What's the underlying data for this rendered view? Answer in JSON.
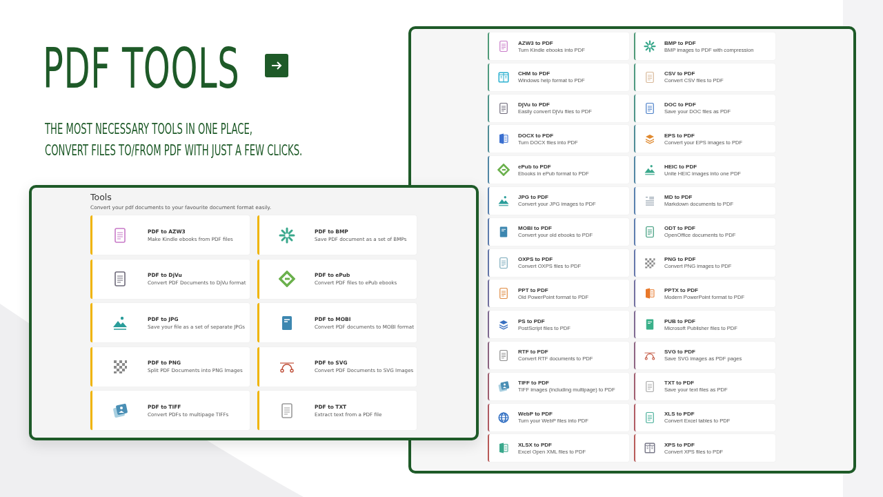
{
  "hero": {
    "title": "PDF TOOLS",
    "subtitle_lines": [
      "THE MOST NECESSARY TOOLS IN ONE PLACE,",
      "CONVERT FILES TO/FROM PDF WITH JUST A FEW CLICKS."
    ]
  },
  "tools_panel": {
    "heading": "Tools",
    "description": "Convert your pdf documents to your favourite document format easily.",
    "cards": [
      {
        "title": "PDF to AZW3",
        "text": "Make Kindle ebooks from PDF files",
        "color": "#f0b400"
      },
      {
        "title": "PDF to BMP",
        "text": "Save PDF document as a set of BMPs",
        "color": "#f0b400"
      },
      {
        "title": "PDF to DjVu",
        "text": "Convert PDF Documents to DjVu format",
        "color": "#f0b400"
      },
      {
        "title": "PDF to ePub",
        "text": "Convert PDF files to ePub ebooks",
        "color": "#f0b400"
      },
      {
        "title": "PDF to JPG",
        "text": "Save your file as a set of separate JPGs",
        "color": "#f0b400"
      },
      {
        "title": "PDF to MOBI",
        "text": "Convert PDF documents to MOBI format",
        "color": "#f0b400"
      },
      {
        "title": "PDF to PNG",
        "text": "Split PDF Documents into PNG Images",
        "color": "#f0b400"
      },
      {
        "title": "PDF to SVG",
        "text": "Convert PDF Documents to SVG Images",
        "color": "#f0b400"
      },
      {
        "title": "PDF to TIFF",
        "text": "Convert PDFs to multipage TIFFs",
        "color": "#f0b400"
      },
      {
        "title": "PDF to TXT",
        "text": "Extract text from a PDF file",
        "color": "#f0b400"
      }
    ]
  },
  "to_pdf_panel": {
    "cards": [
      {
        "title": "AZW3 to PDF",
        "text": "Turn Kindle ebooks into PDF",
        "color": "#4f9a78"
      },
      {
        "title": "BMP to PDF",
        "text": "BMP images to PDF with compression",
        "color": "#4f9a78"
      },
      {
        "title": "CHM to PDF",
        "text": "Windows help format to PDF",
        "color": "#4f9a80"
      },
      {
        "title": "CSV to PDF",
        "text": "Convert CSV files to PDF",
        "color": "#4f9a80"
      },
      {
        "title": "DjVu to PDF",
        "text": "Easily convert DjVu files to PDF",
        "color": "#4e9488"
      },
      {
        "title": "DOC to PDF",
        "text": "Save your DOC files as PDF",
        "color": "#4e9488"
      },
      {
        "title": "DOCX to PDF",
        "text": "Turn DOCX files into PDF",
        "color": "#4f8c96"
      },
      {
        "title": "EPS to PDF",
        "text": "Convert your EPS images to PDF",
        "color": "#4f8c96"
      },
      {
        "title": "ePub to PDF",
        "text": "Ebooks in ePub format to PDF",
        "color": "#5186a4"
      },
      {
        "title": "HEIC to PDF",
        "text": "Unite HEIC images into one PDF",
        "color": "#5186a4"
      },
      {
        "title": "JPG to PDF",
        "text": "Convert your JPG images to PDF",
        "color": "#5880ae"
      },
      {
        "title": "MD to PDF",
        "text": "Markdown documents to PDF",
        "color": "#5880ae"
      },
      {
        "title": "MOBI to PDF",
        "text": "Convert your old ebooks to PDF",
        "color": "#5d7cae"
      },
      {
        "title": "ODT to PDF",
        "text": "OpenOffice documents to PDF",
        "color": "#5d7cae"
      },
      {
        "title": "OXPS to PDF",
        "text": "Convert OXPS files to PDF",
        "color": "#6476aa"
      },
      {
        "title": "PNG to PDF",
        "text": "Convert PNG images to PDF",
        "color": "#6476aa"
      },
      {
        "title": "PPT to PDF",
        "text": "Old PowerPoint format to PDF",
        "color": "#7270a0"
      },
      {
        "title": "PPTX to PDF",
        "text": "Modern PowerPoint format to PDF",
        "color": "#7270a0"
      },
      {
        "title": "PS to PDF",
        "text": "PostScript files to PDF",
        "color": "#7f6a92"
      },
      {
        "title": "PUB to PDF",
        "text": "Microsoft Publisher files to PDF",
        "color": "#7f6a92"
      },
      {
        "title": "RTF to PDF",
        "text": "Convert RTF documents to PDF",
        "color": "#8d6482"
      },
      {
        "title": "SVG to PDF",
        "text": "Save SVG images as PDF pages",
        "color": "#8d6482"
      },
      {
        "title": "TIFF to PDF",
        "text": "TIFF images (including multipage) to PDF",
        "color": "#a05e70"
      },
      {
        "title": "TXT to PDF",
        "text": "Save your text files as PDF",
        "color": "#a05e70"
      },
      {
        "title": "WebP to PDF",
        "text": "Turn your WebP files into PDF",
        "color": "#b05a62"
      },
      {
        "title": "XLS to PDF",
        "text": "Convert Excel tables to PDF",
        "color": "#b05a62"
      },
      {
        "title": "XLSX to PDF",
        "text": "Excel Open XML files to PDF",
        "color": "#b85a58"
      },
      {
        "title": "XPS to PDF",
        "text": "Convert XPS files to PDF",
        "color": "#b85a58"
      }
    ]
  }
}
